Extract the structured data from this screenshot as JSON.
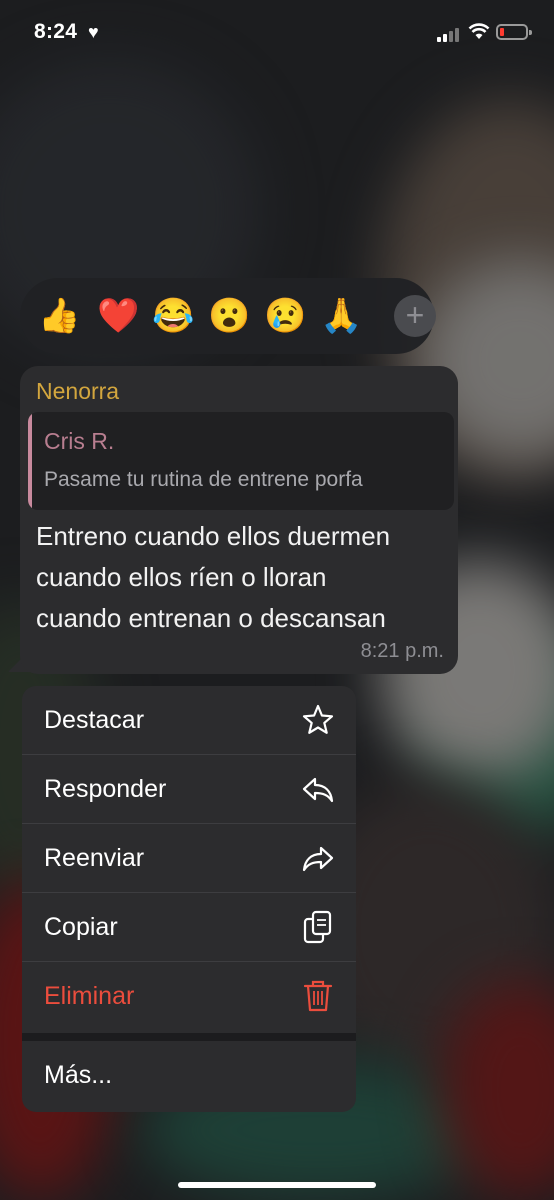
{
  "status": {
    "time": "8:24",
    "heart": "♥"
  },
  "reactions": {
    "emojis": [
      "👍",
      "❤️",
      "😂",
      "😮",
      "😢",
      "🙏"
    ],
    "add": "+"
  },
  "message": {
    "sender": "Nenorra",
    "quote": {
      "name": "Cris R.",
      "text": "Pasame tu rutina de entrene porfa"
    },
    "lines": [
      "Entreno cuando ellos duermen",
      "cuando ellos ríen o lloran",
      "cuando entrenan o descansan"
    ],
    "time": "8:21 p.m."
  },
  "menu": {
    "items": [
      {
        "label": "Destacar",
        "icon": "star-icon"
      },
      {
        "label": "Responder",
        "icon": "reply-icon"
      },
      {
        "label": "Reenviar",
        "icon": "forward-icon"
      },
      {
        "label": "Copiar",
        "icon": "copy-icon"
      },
      {
        "label": "Eliminar",
        "icon": "trash-icon"
      }
    ],
    "more": "Más..."
  },
  "colors": {
    "sender": "#d3a63e",
    "quote_name": "#b87e90",
    "delete": "#eb4d3d"
  }
}
